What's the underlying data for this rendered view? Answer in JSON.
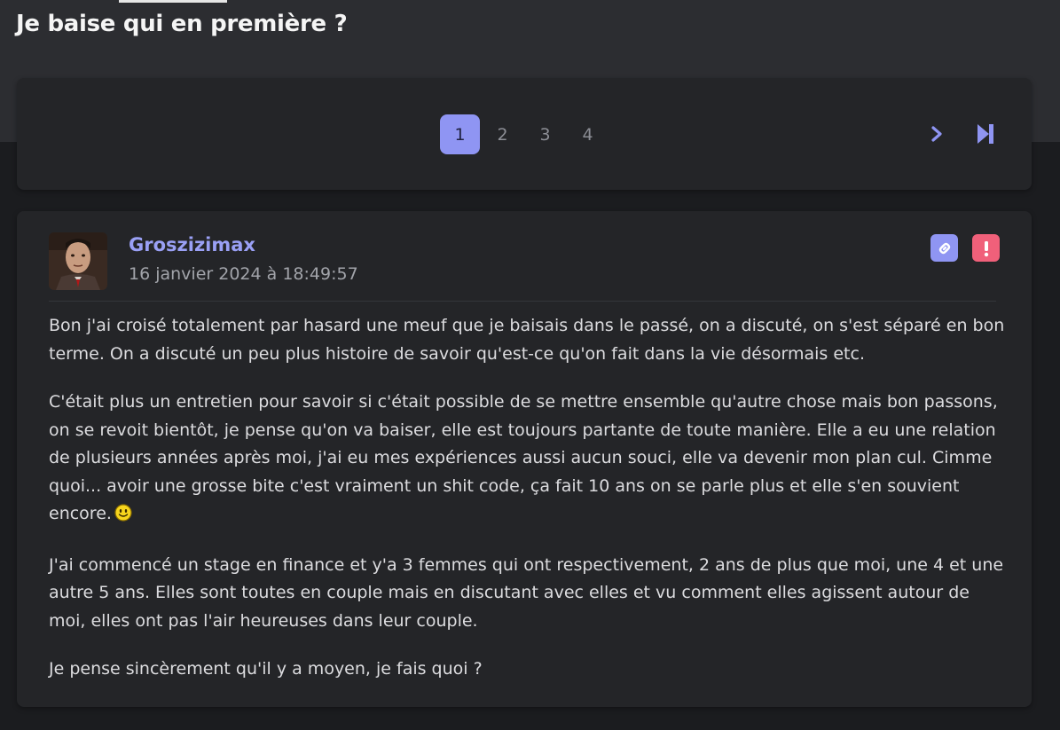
{
  "topic": {
    "title": "Je baise qui en première ?"
  },
  "pagination": {
    "pages": [
      "1",
      "2",
      "3",
      "4"
    ],
    "current": "1",
    "next_icon": "chevron-right-icon",
    "last_icon": "skip-to-last-icon",
    "accent_color": "#8f95f3"
  },
  "post": {
    "author": "Groszizimax",
    "date": "16 janvier 2024 à 18:49:57",
    "avatar": "user-avatar",
    "actions": {
      "link_icon": "link-icon",
      "report_icon": "alert-exclamation-icon",
      "report_color": "#f0607a"
    },
    "paragraphs": [
      "Bon j'ai croisé totalement par hasard une meuf que je baisais dans le passé, on a discuté, on s'est séparé en bon terme. On a discuté un peu plus histoire de savoir qu'est-ce qu'on fait dans la vie désormais etc.",
      "C'était plus un entretien pour savoir si c'était possible de se mettre ensemble qu'autre chose mais bon passons, on se revoit bientôt, je pense qu'on va baiser, elle est toujours partante de toute manière. Elle a eu une relation de plusieurs années après moi, j'ai eu mes expériences aussi aucun souci, elle va devenir mon plan cul. Cimme quoi... avoir une grosse bite c'est vraiment un shit code, ça fait 10 ans on se parle plus et elle s'en souvient encore.",
      "J'ai commencé un stage en finance et y'a 3 femmes qui ont respectivement, 2 ans de plus que moi, une 4 et une autre 5 ans. Elles sont toutes en couple mais en discutant avec elles et vu comment elles agissent autour de moi, elles ont pas l'air heureuses dans leur couple.",
      "Je pense sincèrement qu'il y a moyen, je fais quoi ?"
    ],
    "smiley_icon": "smiley-icon"
  }
}
